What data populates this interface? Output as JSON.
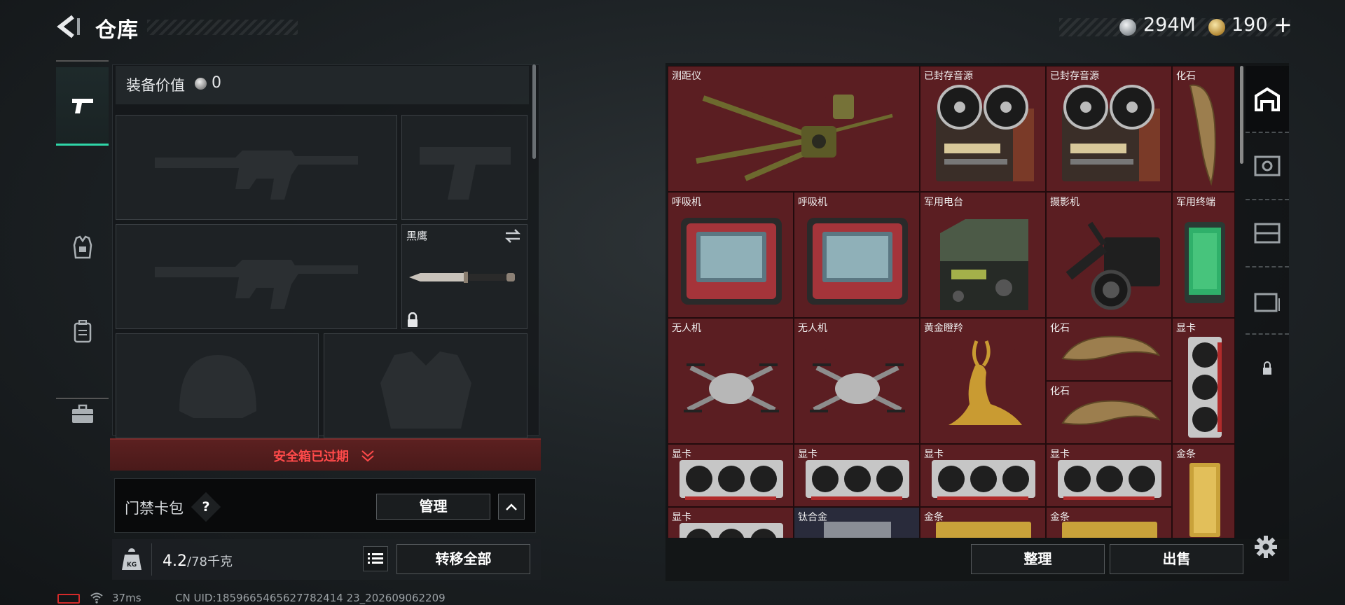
{
  "header": {
    "title": "仓库"
  },
  "currency": {
    "silver": "294M",
    "gold": "190",
    "plus": "+"
  },
  "equipment": {
    "value_label": "装备价值",
    "value": "0",
    "melee_name": "黑鹰",
    "secure_case_status": "安全箱已过期"
  },
  "card_wallet": {
    "label": "门禁卡包",
    "help": "?",
    "manage_label": "管理"
  },
  "weight": {
    "current": "4.2",
    "unit": "/78千克"
  },
  "buttons": {
    "transfer_all": "转移全部",
    "sort": "整理",
    "sell": "出售"
  },
  "colors": {
    "accent": "#2fd6a8",
    "stash_bg": "#5a1f22",
    "alert": "#ff4a4a"
  },
  "stash_items": [
    {
      "name": "测距仪",
      "icon": "rangefinder-icon"
    },
    {
      "name": "已封存音源",
      "icon": "reel-recorder-icon"
    },
    {
      "name": "已封存音源",
      "icon": "reel-recorder-icon"
    },
    {
      "name": "化石",
      "icon": "fossil-claw-icon"
    },
    {
      "name": "呼吸机",
      "icon": "ventilator-icon"
    },
    {
      "name": "呼吸机",
      "icon": "ventilator-icon"
    },
    {
      "name": "军用电台",
      "icon": "radio-icon"
    },
    {
      "name": "摄影机",
      "icon": "camera-icon"
    },
    {
      "name": "军用终端",
      "icon": "terminal-icon"
    },
    {
      "name": "无人机",
      "icon": "drone-icon"
    },
    {
      "name": "无人机",
      "icon": "drone-icon"
    },
    {
      "name": "黄金瞪羚",
      "icon": "golden-gazelle-icon"
    },
    {
      "name": "化石",
      "icon": "fossil-claw-icon"
    },
    {
      "name": "化石",
      "icon": "fossil-claw-icon"
    },
    {
      "name": "显卡",
      "icon": "gpu-icon"
    },
    {
      "name": "显卡",
      "icon": "gpu-icon"
    },
    {
      "name": "显卡",
      "icon": "gpu-icon"
    },
    {
      "name": "显卡",
      "icon": "gpu-icon"
    },
    {
      "name": "显卡",
      "icon": "gpu-icon"
    },
    {
      "name": "金条",
      "icon": "gold-bar-icon"
    },
    {
      "name": "显卡",
      "icon": "gpu-icon"
    },
    {
      "name": "钛合金",
      "icon": "titanium-icon"
    },
    {
      "name": "金条",
      "icon": "gold-bar-icon"
    },
    {
      "name": "金条",
      "icon": "gold-bar-icon"
    }
  ],
  "status": {
    "ping": "37ms",
    "uid": "CN UID:1859665465627782414 23_202609062209"
  }
}
